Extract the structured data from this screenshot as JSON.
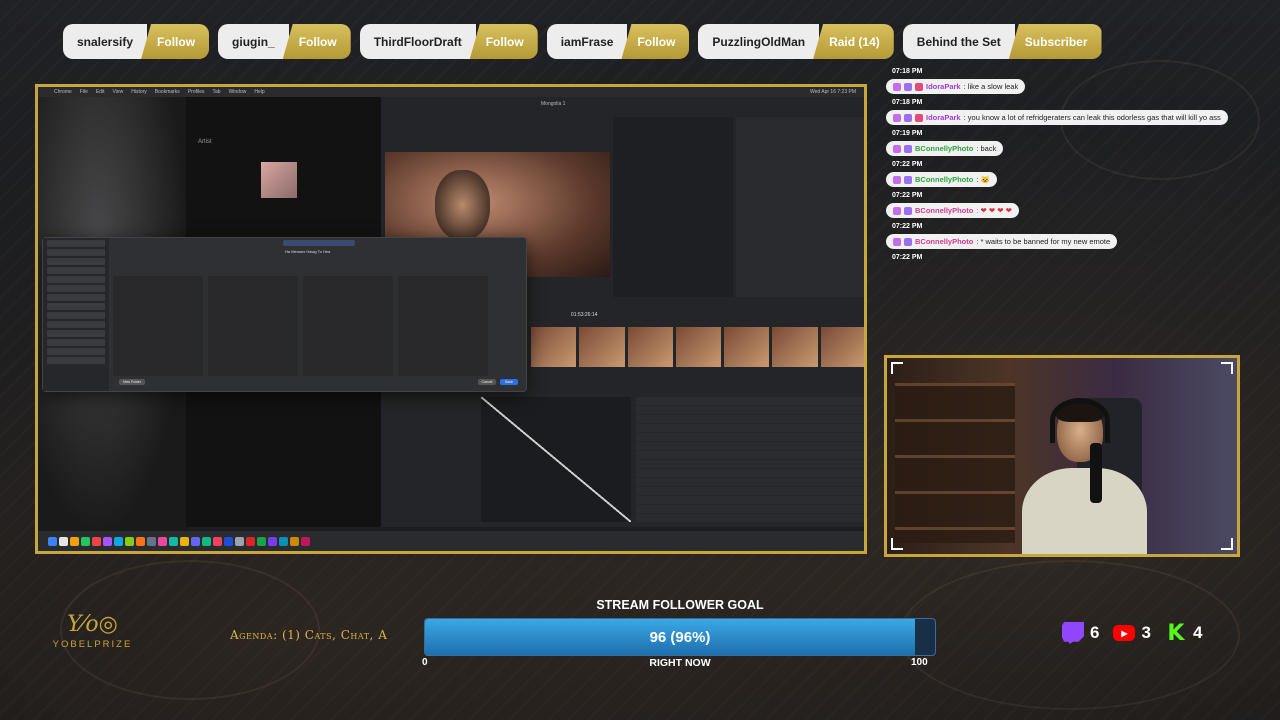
{
  "events": [
    {
      "name": "snalersify",
      "action": "Follow"
    },
    {
      "name": "giugin_",
      "action": "Follow"
    },
    {
      "name": "ThirdFloorDraft",
      "action": "Follow"
    },
    {
      "name": "iamFrase",
      "action": "Follow"
    },
    {
      "name": "PuzzlingOldMan",
      "action": "Raid (14)"
    },
    {
      "name": "Behind the Set",
      "action": "Subscriber"
    }
  ],
  "screen": {
    "menubar": [
      "Chrome",
      "File",
      "Edit",
      "View",
      "History",
      "Bookmarks",
      "Profiles",
      "Tab",
      "Window",
      "Help"
    ],
    "clock": "Wed Apr 16 7:23 PM",
    "artist_label": "Artist",
    "timecode": "01:53:26:14",
    "project": "Mongolia 1",
    "dialog_filename": "Ha Mensex Hawg To Hea",
    "dialog_new_folder": "New Folder",
    "dialog_cancel": "Cancel",
    "dialog_save": "Save"
  },
  "chat": [
    {
      "time": "07:18 PM",
      "user": "IdoraPark",
      "user_color": "purple",
      "text": ": like a slow leak"
    },
    {
      "time": "07:18 PM",
      "user": "IdoraPark",
      "user_color": "purple",
      "text": ": you know a lot of refridgeraters can leak this odorless gas that will kill yo ass"
    },
    {
      "time": "07:19 PM",
      "user": "BConnellyPhoto",
      "user_color": "green",
      "text": ": back"
    },
    {
      "time": "07:22 PM",
      "user": "BConnellyPhoto",
      "user_color": "green",
      "text": ": 🐱"
    },
    {
      "time": "07:22 PM",
      "user": "BConnellyPhoto",
      "user_color": "pink",
      "text": ": ❤ ❤ ❤ ❤"
    },
    {
      "time": "07:22 PM",
      "user": "BConnellyPhoto",
      "user_color": "pink",
      "text": ": * waits to be banned for my new emote"
    }
  ],
  "chat_last_time": "07:22 PM",
  "branding": {
    "logo_text": "YOBELPRIZE"
  },
  "agenda": "Agenda: (1) Cats, Chat, A",
  "goal": {
    "title": "STREAM FOLLOWER GOAL",
    "value_text": "96 (96%)",
    "progress": 0.96,
    "min": "0",
    "max": "100",
    "subtitle": "RIGHT NOW"
  },
  "platforms": [
    {
      "icon": "twitch-icon",
      "count": "6"
    },
    {
      "icon": "youtube-icon",
      "count": "3"
    },
    {
      "icon": "kick-icon",
      "count": "4"
    }
  ],
  "colors": {
    "accent_gold": "#c7a73c",
    "goal_blue": "#3aa8e6"
  }
}
